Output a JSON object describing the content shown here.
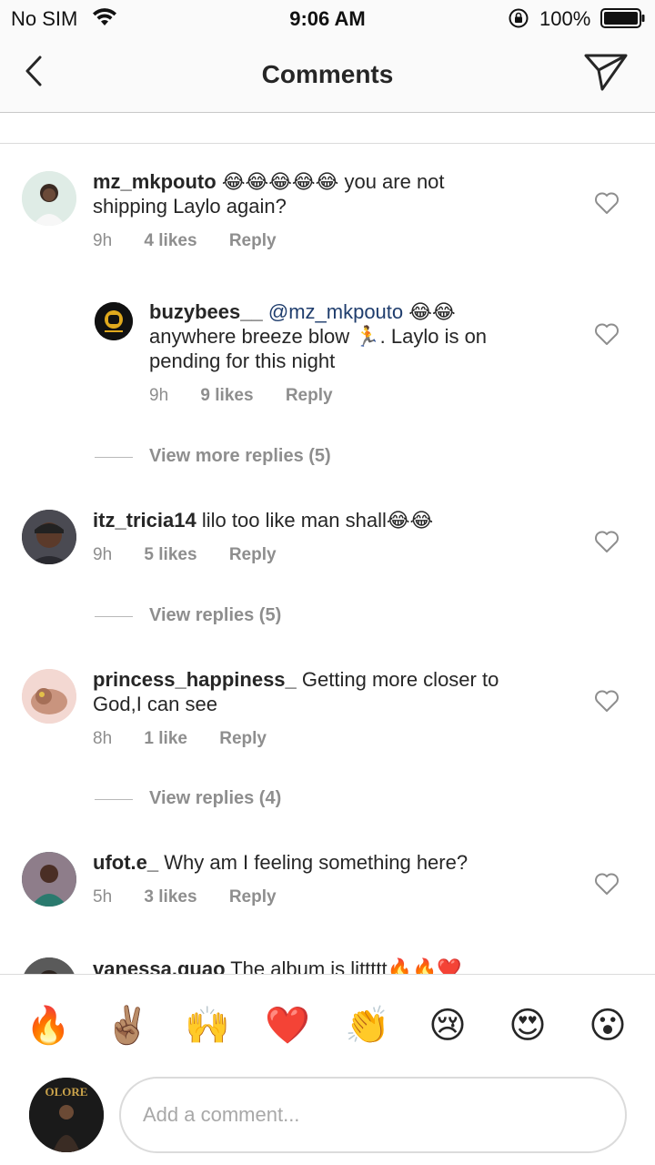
{
  "status": {
    "carrier": "No SIM",
    "time": "9:06 AM",
    "battery": "100%"
  },
  "nav": {
    "title": "Comments"
  },
  "comments": [
    {
      "username": "mz_mkpouto",
      "text_line1": "😂😂😂😂😂 you are not",
      "text_line2": "shipping Laylo again?",
      "time": "9h",
      "likes": "4 likes",
      "reply": "Reply"
    },
    {
      "username": "buzybees__",
      "mention": "@mz_mkpouto",
      "text_line1": "😂😂",
      "text_line2": "anywhere breeze blow 🏃. Laylo is on",
      "text_line3": "pending for this night",
      "time": "9h",
      "likes": "9 likes",
      "reply": "Reply",
      "more_replies": "View more replies (5)"
    },
    {
      "username": "itz_tricia14",
      "text_line1": "lilo too like man shall😂😂",
      "time": "9h",
      "likes": "5 likes",
      "reply": "Reply",
      "view_replies": "View replies (5)"
    },
    {
      "username": "princess_happiness_",
      "text_line1": "Getting more closer to",
      "text_line2": "God,I can see",
      "time": "8h",
      "likes": "1 like",
      "reply": "Reply",
      "view_replies": "View replies (4)"
    },
    {
      "username": "ufot.e_",
      "text_line1": "Why am I feeling something here?",
      "time": "5h",
      "likes": "3 likes",
      "reply": "Reply"
    },
    {
      "username": "vanessa.quao",
      "text_line1": "The album is littttt🔥🔥❤️"
    }
  ],
  "emoji_bar": {
    "emojis": [
      "🔥",
      "✌🏽",
      "🙌",
      "❤️",
      "👏",
      "😢",
      "😍",
      "😮"
    ]
  },
  "composer": {
    "placeholder": "Add a comment...",
    "avatar_text": "OLORE"
  },
  "colors": {
    "username_mention": "#1f3d6d",
    "meta_grey": "#8e8e8e",
    "separator": "#dbdbdb"
  }
}
